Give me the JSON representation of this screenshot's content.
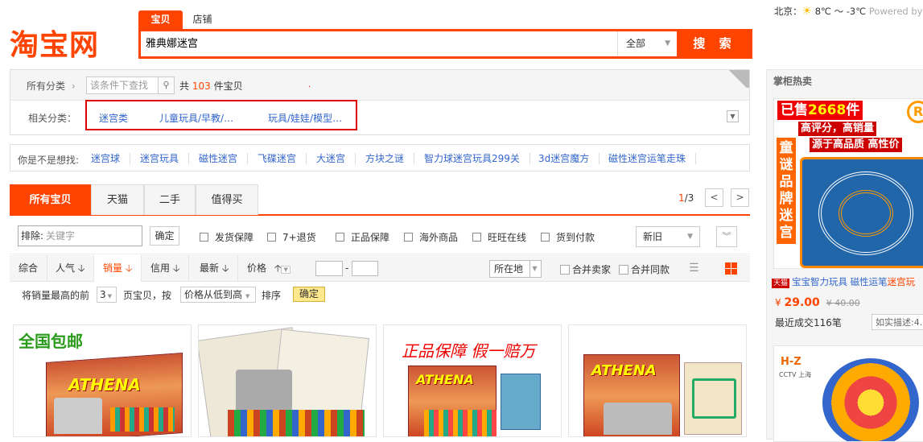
{
  "header": {
    "logo_text": "淘宝网",
    "search_tabs": [
      "宝贝",
      "店铺"
    ],
    "search_value": "雅典娜迷宫",
    "search_category": "全部",
    "search_button": "搜 索"
  },
  "weather": {
    "city": "北京：",
    "temp": "8℃ ～ -3℃",
    "powered": "Powered by"
  },
  "category_panel": {
    "all_label": "所有分类",
    "filter_placeholder": "该条件下查找",
    "count_prefix": "共",
    "count": "103",
    "count_suffix": "件宝贝",
    "related_label": "相关分类：",
    "related": [
      "迷宫类",
      "儿童玩具/早教/…",
      "玩具/娃娃/模型…"
    ]
  },
  "suggest": {
    "label": "你是不是想找:",
    "items": [
      "迷宫球",
      "迷宫玩具",
      "磁性迷宫",
      "飞碟迷宫",
      "大迷宫",
      "方块之谜",
      "智力球迷宫玩具299关",
      "3d迷宫魔方",
      "磁性迷宫运笔走珠"
    ]
  },
  "tabs": [
    "所有宝贝",
    "天猫",
    "二手",
    "值得买"
  ],
  "pager": {
    "current": "1",
    "total": "/3",
    "prev": "<",
    "next": ">"
  },
  "filters": {
    "exclude_label": "排除:",
    "exclude_placeholder": "关键字",
    "confirm": "确定",
    "checkboxes": [
      "发货保障",
      "7+退货",
      "正品保障",
      "海外商品",
      "旺旺在线",
      "货到付款"
    ],
    "condition": "新旧"
  },
  "sort": {
    "items": [
      "综合",
      "人气",
      "销量",
      "信用",
      "最新",
      "价格"
    ],
    "location": "所在地",
    "merge_seller": "合并卖家",
    "merge_same": "合并同款"
  },
  "top_sales": {
    "label1": "将销量最高的前",
    "num": "3",
    "label2": "页宝贝，按",
    "order": "价格从低到高",
    "label3": "排序",
    "confirm": "确定"
  },
  "cards": [
    {
      "banner": "全国包邮",
      "brand": "ATHENA"
    },
    {
      "banner": "",
      "brand": ""
    },
    {
      "banner": "正品保障 假一赔万",
      "brand": "ATHENA"
    },
    {
      "banner": "",
      "brand": "ATHENA"
    }
  ],
  "sidebar": {
    "title": "掌柜热卖",
    "sold_prefix": "已售",
    "sold_count": "2668",
    "sold_suffix": "件",
    "headline1": "高评分，高销量",
    "headline2": "源于高品质 高性价",
    "vertical_text": "童谜品牌迷宫",
    "reg_mark": "R",
    "tmall_tag": "天猫",
    "item_title": "宝宝智力玩具 磁性运笔",
    "item_title_hl": "迷宫玩",
    "currency": "¥",
    "price": "29.00",
    "old_price": "¥ 40.00",
    "deal": "最近成交116笔",
    "desc": "如实描述:4.",
    "logo2": "H-Z",
    "logo2_sub": "CCTV 上海"
  }
}
